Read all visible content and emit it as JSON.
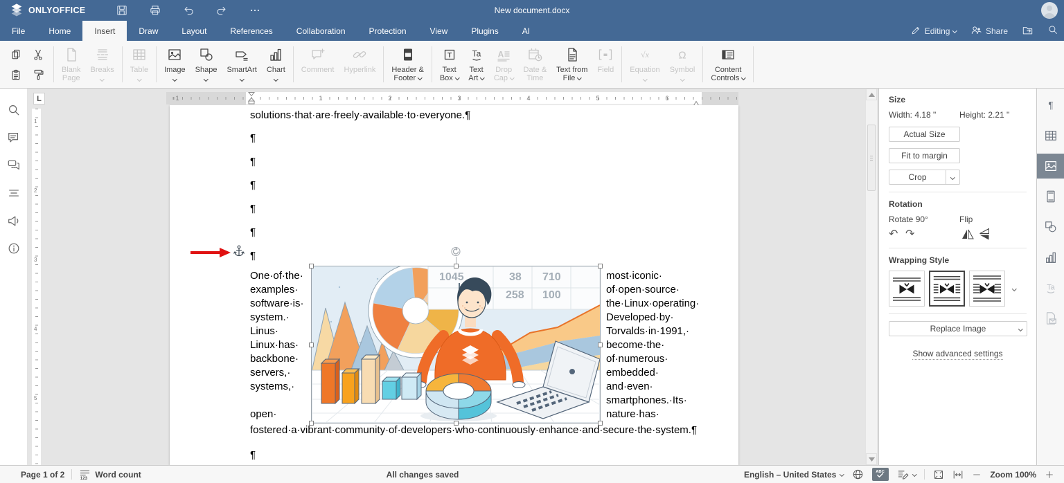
{
  "colors": {
    "header_blue": "#446995",
    "ribbon_bg": "#f7f7f7",
    "workspace_bg": "#e5e5e5",
    "active_tool_bg": "#7c8793",
    "red_arrow": "#e01212"
  },
  "titlebar": {
    "app_name": "ONLYOFFICE",
    "document_title": "New document.docx"
  },
  "menu_tabs": [
    {
      "label": "File"
    },
    {
      "label": "Home"
    },
    {
      "label": "Insert",
      "active": true
    },
    {
      "label": "Draw"
    },
    {
      "label": "Layout"
    },
    {
      "label": "References"
    },
    {
      "label": "Collaboration"
    },
    {
      "label": "Protection"
    },
    {
      "label": "View"
    },
    {
      "label": "Plugins"
    },
    {
      "label": "AI"
    }
  ],
  "topbar_right": {
    "editing_label": "Editing",
    "share_label": "Share"
  },
  "ribbon": {
    "clipboard_icons": [
      {
        "name": "copy"
      },
      {
        "name": "cut"
      },
      {
        "name": "paste"
      },
      {
        "name": "format-painter"
      }
    ],
    "groups": [
      [
        {
          "icon": "blank-page",
          "lines": [
            "Blank",
            "Page"
          ],
          "disabled": true
        },
        {
          "icon": "breaks",
          "lines": [
            "Breaks"
          ],
          "caret": true,
          "disabled": true
        }
      ],
      [
        {
          "icon": "table",
          "lines": [
            "Table"
          ],
          "caret": true,
          "disabled": true
        }
      ],
      [
        {
          "icon": "image",
          "lines": [
            "Image"
          ],
          "caret": true
        },
        {
          "icon": "shape",
          "lines": [
            "Shape"
          ],
          "caret": true
        },
        {
          "icon": "smartart",
          "lines": [
            "SmartArt"
          ],
          "caret": true
        },
        {
          "icon": "chart",
          "lines": [
            "Chart"
          ],
          "caret": true
        }
      ],
      [
        {
          "icon": "comment",
          "lines": [
            "Comment"
          ],
          "disabled": true
        },
        {
          "icon": "hyperlink",
          "lines": [
            "Hyperlink"
          ],
          "disabled": true
        }
      ],
      [
        {
          "icon": "header-footer",
          "lines": [
            "Header &",
            "Footer"
          ],
          "caret": true
        }
      ],
      [
        {
          "icon": "text-box",
          "lines": [
            "Text",
            "Box"
          ],
          "caret": true
        },
        {
          "icon": "text-art",
          "lines": [
            "Text",
            "Art"
          ],
          "caret": true
        },
        {
          "icon": "drop-cap",
          "lines": [
            "Drop",
            "Cap"
          ],
          "caret": true,
          "disabled": true
        },
        {
          "icon": "date-time",
          "lines": [
            "Date &",
            "Time"
          ],
          "disabled": true
        },
        {
          "icon": "text-from-file",
          "lines": [
            "Text from",
            "File"
          ],
          "caret": true
        },
        {
          "icon": "field",
          "lines": [
            "Field"
          ],
          "disabled": true
        }
      ],
      [
        {
          "icon": "equation",
          "lines": [
            "Equation"
          ],
          "caret": true,
          "disabled": true
        },
        {
          "icon": "symbol",
          "lines": [
            "Symbol"
          ],
          "caret": true,
          "disabled": true
        }
      ],
      [
        {
          "icon": "content-controls",
          "lines": [
            "Content",
            "Controls"
          ],
          "caret": true
        }
      ]
    ]
  },
  "sidebar_icons": [
    {
      "name": "search"
    },
    {
      "name": "comment"
    },
    {
      "name": "chat"
    },
    {
      "name": "navigation"
    },
    {
      "name": "feedback"
    },
    {
      "name": "about"
    }
  ],
  "edge_icons": [
    {
      "name": "paragraph-settings",
      "icon": "paragraph"
    },
    {
      "name": "table-settings",
      "icon": "table"
    },
    {
      "name": "image-settings",
      "icon": "image",
      "active": true
    },
    {
      "name": "headerfooter-settings",
      "icon": "page-s"
    },
    {
      "name": "shape-settings",
      "icon": "shapes-s"
    },
    {
      "name": "chart-settings",
      "icon": "chart"
    },
    {
      "name": "textart-settings",
      "icon": "text-art",
      "disabled": true
    },
    {
      "name": "mailmerge-settings",
      "icon": "mailmerge",
      "disabled": true
    }
  ],
  "ruler": {
    "tab_selector": "L",
    "left_number": "1",
    "numbers": [
      "1",
      "2",
      "3",
      "4",
      "5",
      "6"
    ],
    "vertical_numbers": [
      "1",
      "2",
      "3",
      "4",
      "5"
    ]
  },
  "document": {
    "first_line": "solutions·that·are·freely·available·to·everyone.¶",
    "empty_paragraphs": [
      "¶",
      "¶",
      "¶",
      "¶",
      "¶"
    ],
    "anchor_pilcrow": "¶",
    "left_column": [
      "One·of·the·",
      "examples·",
      "software·is·",
      "system.·",
      "Linus·",
      "Linux·has·",
      "backbone·",
      "servers,·",
      "systems,·"
    ],
    "left_column_tail": "open·",
    "right_column": [
      "most·iconic·",
      "of·open·source·",
      "the·Linux·operating·",
      "Developed·by·",
      "Torvalds·in·1991,·",
      "become·the·",
      "of·numerous·",
      "embedded·",
      "and·even·",
      "smartphones.·Its·",
      "nature·has·"
    ],
    "closing_line": "fostered·a·vibrant·community·of·developers·who·continuously·enhance·and·secure·the·system.¶",
    "trailing_pilcrow": "¶",
    "illustration": {
      "table_row1": [
        "1045",
        "38",
        "710"
      ],
      "table_row2": [
        "258",
        "100"
      ]
    }
  },
  "right_panel": {
    "size_title": "Size",
    "width_label": "Width: 4.18 \"",
    "height_label": "Height: 2.21 \"",
    "actual_size_label": "Actual Size",
    "fit_to_margin_label": "Fit to margin",
    "crop_label": "Crop",
    "rotation_title": "Rotation",
    "rotate_label": "Rotate 90°",
    "flip_label": "Flip",
    "wrapping_title": "Wrapping Style",
    "wrapping_styles": [
      {
        "name": "inline"
      },
      {
        "name": "square",
        "selected": true
      },
      {
        "name": "tight"
      }
    ],
    "replace_image_label": "Replace Image",
    "advanced_settings_label": "Show advanced settings"
  },
  "statusbar": {
    "page_label": "Page 1 of 2",
    "word_count_label": "Word count",
    "save_status": "All changes saved",
    "language": "English – United States",
    "zoom_label": "Zoom 100%"
  }
}
